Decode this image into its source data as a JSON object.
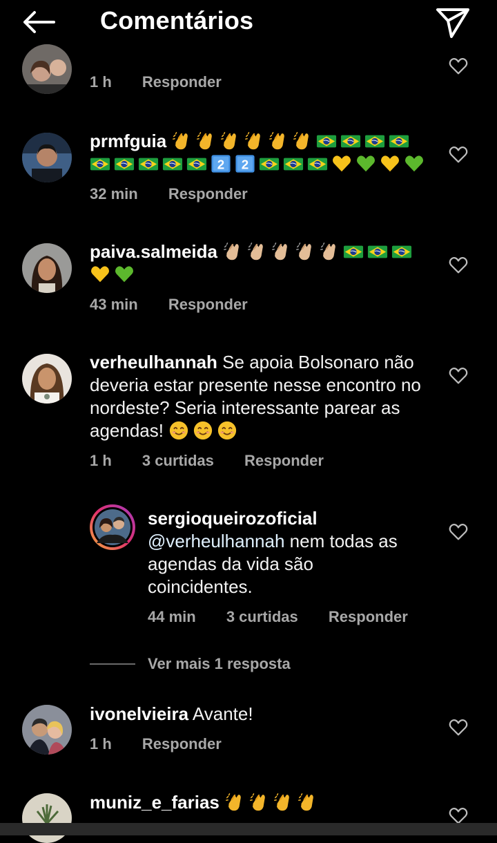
{
  "header": {
    "title": "Comentários",
    "back_icon": "arrow-left-icon",
    "share_icon": "paper-plane-icon"
  },
  "comments": [
    {
      "username": "",
      "text": "",
      "time": "1 h",
      "likes": "",
      "reply": "Responder"
    },
    {
      "username": "prmfguia",
      "text": "",
      "emojis": "👏👏👏👏👏👏🇧🇷🇧🇷🇧🇷🇧🇷🇧🇷🇧🇷🇧🇷🇧🇷🇧🇷2️⃣2️⃣🇧🇷🇧🇷🇧🇷💛💚💛💚",
      "time": "32 min",
      "likes": "",
      "reply": "Responder"
    },
    {
      "username": "paiva.salmeida",
      "text": "",
      "emojis": "👏🏼👏🏼👏🏼👏🏼👏🏼🇧🇷🇧🇷🇧🇷💛💚",
      "time": "43 min",
      "likes": "",
      "reply": "Responder"
    },
    {
      "username": "verheulhannah",
      "text": "Se apoia Bolsonaro não deveria estar presente nesse encontro no nordeste? Seria interessante parear as agendas!",
      "emojis": "😊😊😊",
      "time": "1 h",
      "likes": "3 curtidas",
      "reply": "Responder"
    },
    {
      "username": "sergioqueirozoficial",
      "mention": "@verheulhannah",
      "text": "nem todas as agendas da vida são coincidentes.",
      "time": "44 min",
      "likes": "3 curtidas",
      "reply": "Responder"
    },
    {
      "username": "ivonelvieira",
      "text": "Avante!",
      "time": "1 h",
      "likes": "",
      "reply": "Responder"
    },
    {
      "username": "muniz_e_farias",
      "text": "",
      "emojis": "👏👏👏👏",
      "time": "",
      "likes": "",
      "reply": ""
    }
  ],
  "view_more": "Ver mais 1 resposta",
  "colors": {
    "background": "#000000",
    "meta": "#a8a8a8",
    "flag_green": "#1e9e3e",
    "flag_yellow": "#f6d21b",
    "flag_blue": "#1d3c8f",
    "heart_yellow": "#f7c21b",
    "heart_green": "#5cb82d",
    "clap": "#f3b52a",
    "clap_tone": "#e3bd97",
    "keycap": "#3f8fe3"
  },
  "icons": {
    "heart": "heart-outline-icon"
  }
}
